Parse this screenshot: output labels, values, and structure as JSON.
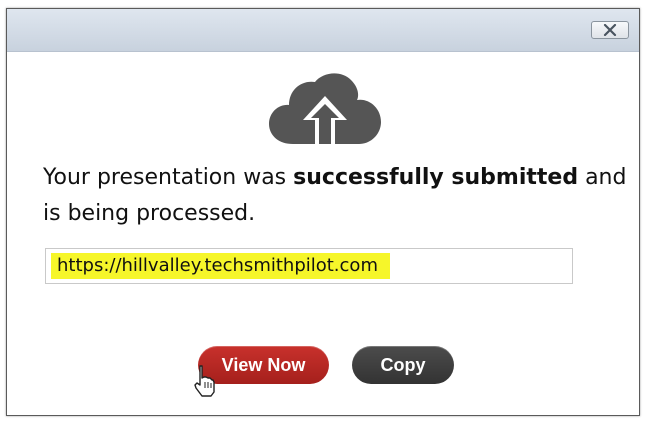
{
  "dialog": {
    "close_icon": "close-x-icon"
  },
  "upload": {
    "icon": "cloud-upload-icon"
  },
  "message": {
    "text_before": "Your presentation was ",
    "text_bold": "successfully submitted",
    "text_after": " and is being processed."
  },
  "url_field": {
    "value": "https://hillvalley.techsmithpilot.com"
  },
  "buttons": {
    "view_now": "View Now",
    "copy": "Copy"
  },
  "colors": {
    "view_now_bg": "#b52521",
    "copy_bg": "#3e3e3e",
    "url_highlight": "#f6f62a",
    "cloud": "#555555"
  }
}
